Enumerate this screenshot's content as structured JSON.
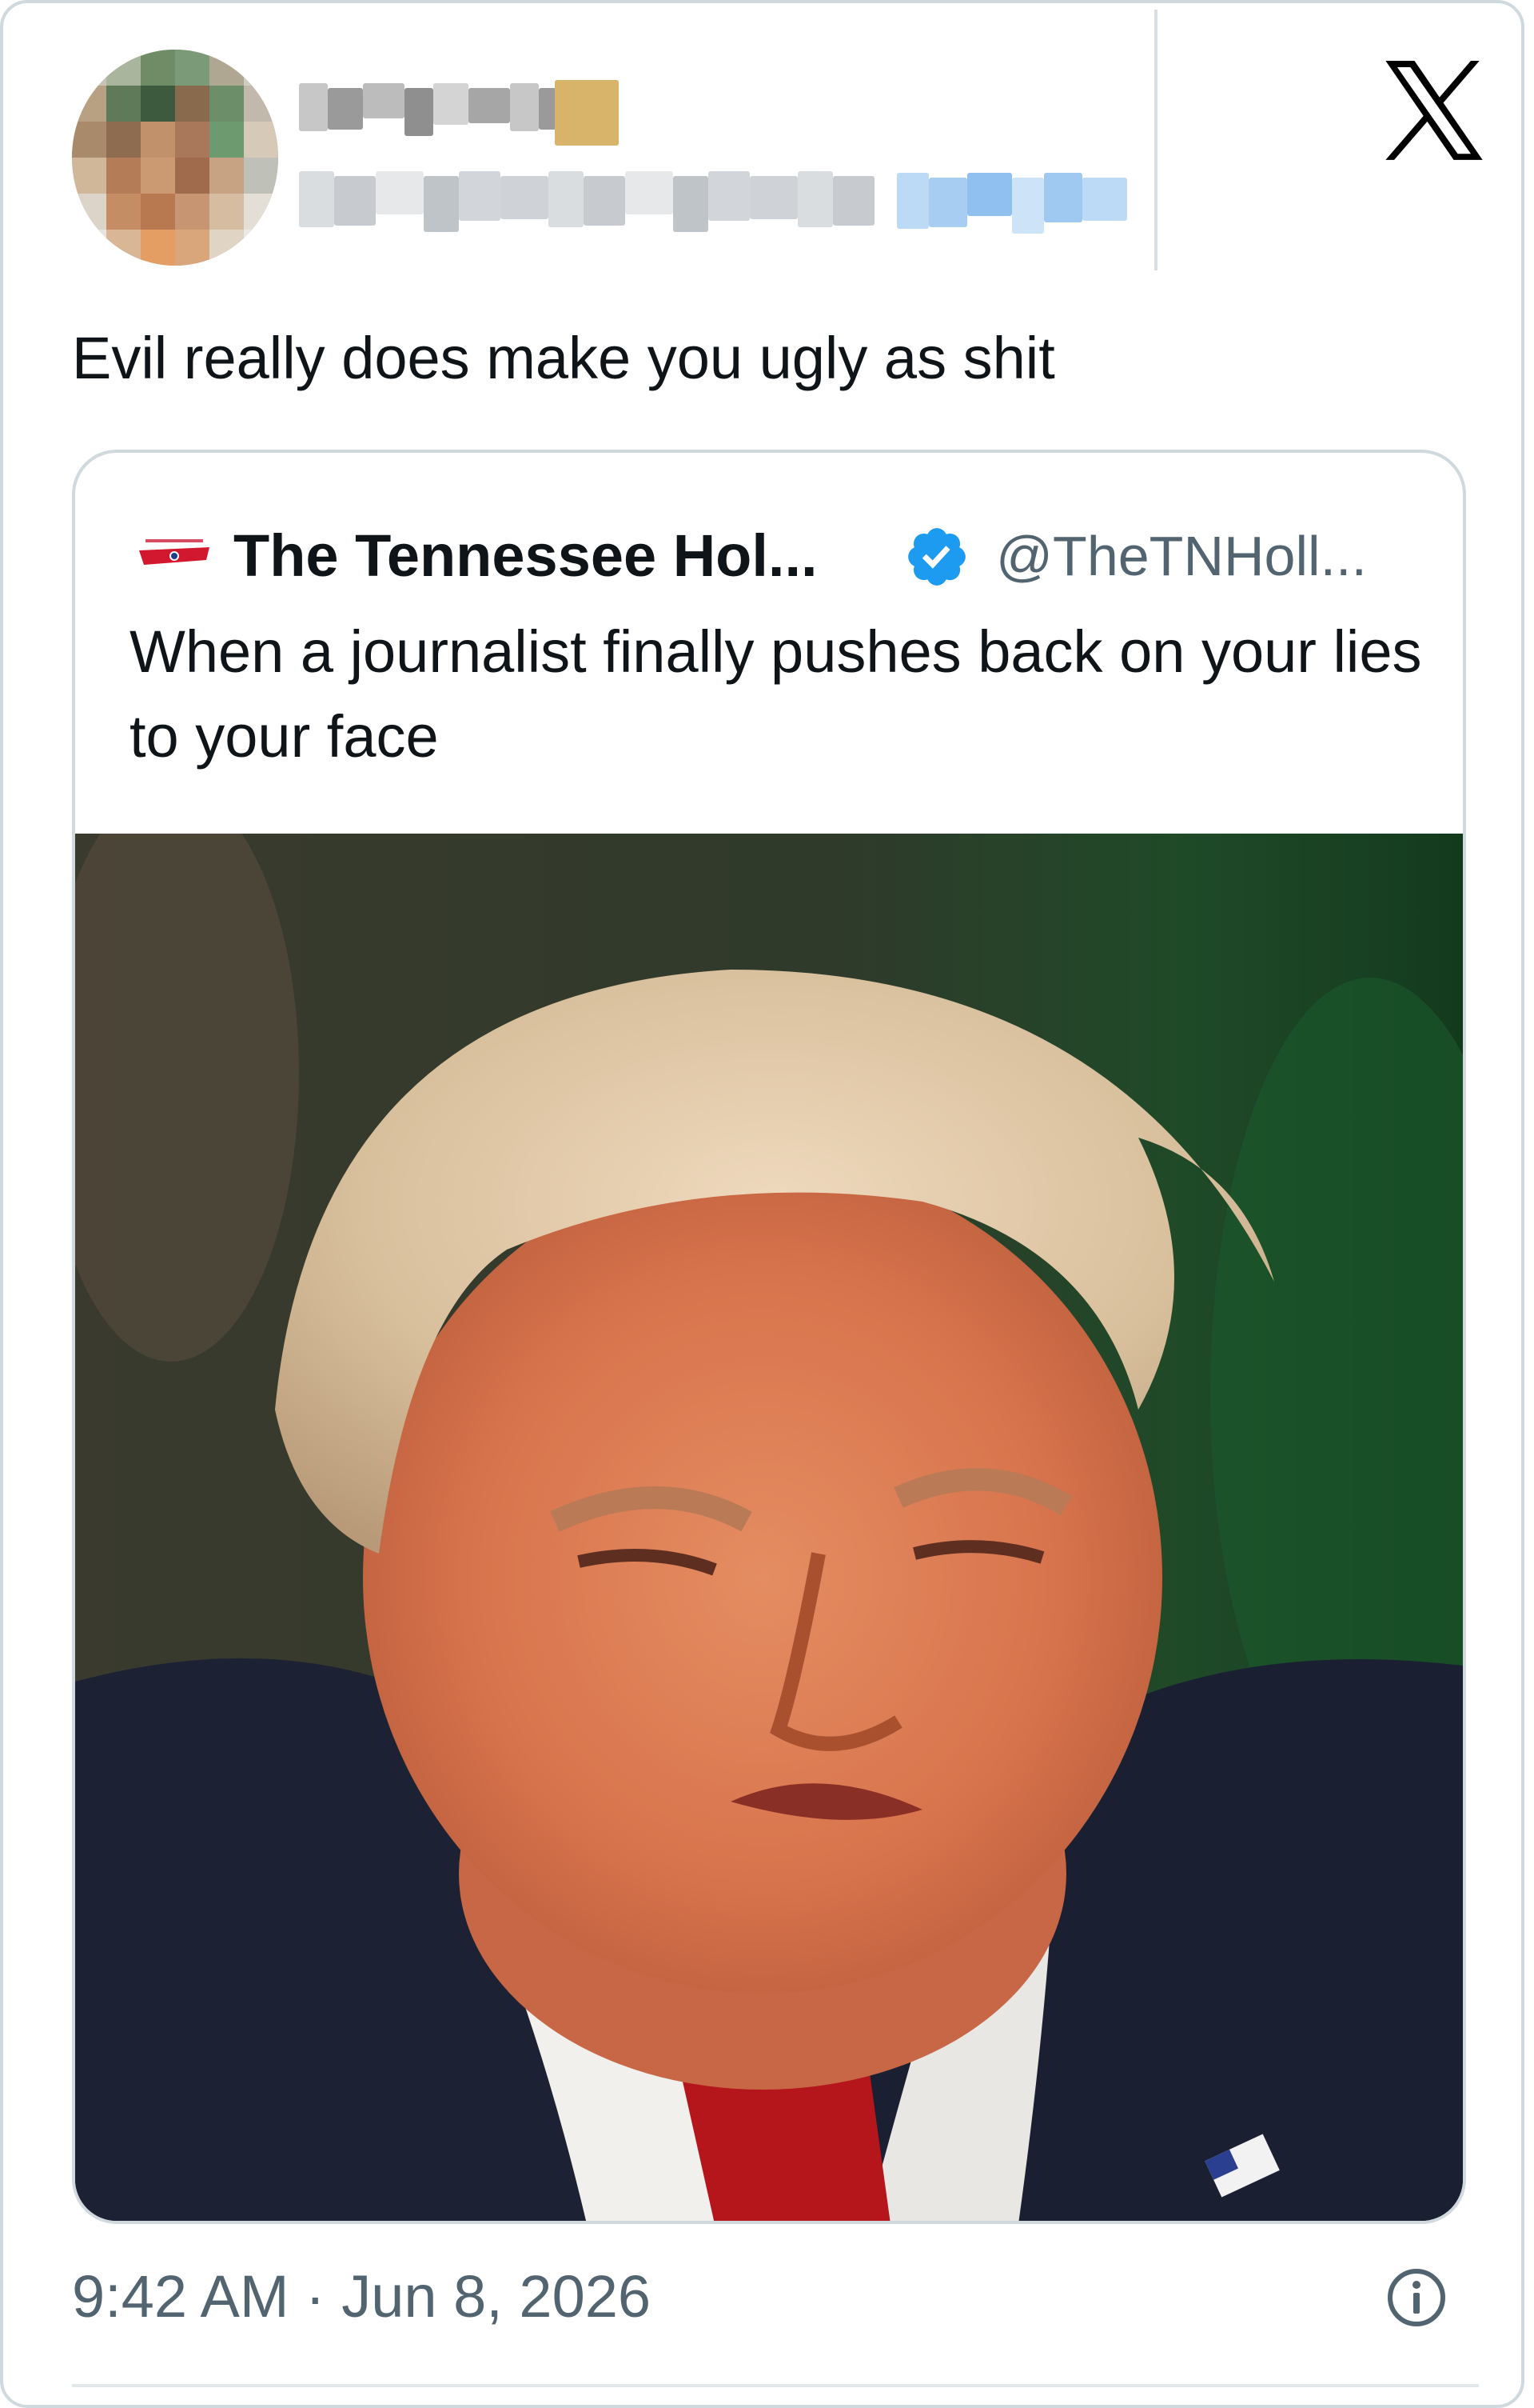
{
  "window": {
    "brand_icon": "x-logo-icon"
  },
  "author": {
    "avatar_icon": "pixelated-avatar",
    "display_name_obscured": true,
    "handle_obscured": true,
    "follow_link_obscured": true
  },
  "tweet": {
    "text": "Evil really does make you ugly as shit",
    "timestamp": "9:42 AM · Jun 8, 2026",
    "info_icon": "info-icon"
  },
  "quoted_tweet": {
    "logo_icon": "tennessee-holler-logo",
    "display_name": "The Tennessee Hol...",
    "verified_icon": "verified-badge-icon",
    "handle": "@TheTNHoll...",
    "text": "When a journalist finally pushes back on your lies to your face",
    "media_icon": "photo-portrait"
  },
  "colors": {
    "text_primary": "#0f1419",
    "text_secondary": "#536471",
    "border": "#cfd9de",
    "verified_blue": "#1d9bf0",
    "x_black": "#000000"
  }
}
